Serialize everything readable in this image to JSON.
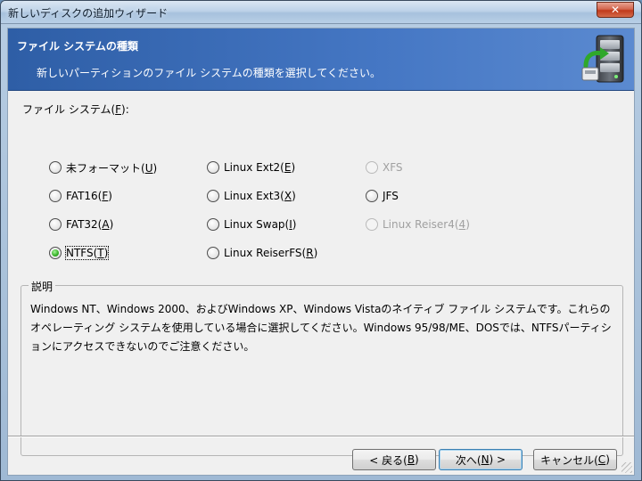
{
  "window": {
    "title": "新しいディスクの追加ウィザード",
    "close_label": "✕"
  },
  "header": {
    "title": "ファイル システムの種類",
    "subtitle": "新しいパーティションのファイル システムの種類を選択してください。",
    "icon": "server-disk-icon"
  },
  "filesystem": {
    "label_prefix": "ファイル システム(",
    "label_key": "F",
    "label_suffix": "):",
    "options": [
      {
        "prefix": "未フォーマット(",
        "key": "U",
        "suffix": ")",
        "checked": false,
        "disabled": false
      },
      {
        "prefix": "FAT16(",
        "key": "F",
        "suffix": ")",
        "checked": false,
        "disabled": false
      },
      {
        "prefix": "FAT32(",
        "key": "A",
        "suffix": ")",
        "checked": false,
        "disabled": false
      },
      {
        "prefix": "NTFS(",
        "key": "T",
        "suffix": ")",
        "checked": true,
        "disabled": false
      },
      {
        "prefix": "Linux Ext2(",
        "key": "E",
        "suffix": ")",
        "checked": false,
        "disabled": false
      },
      {
        "prefix": "Linux Ext3(",
        "key": "X",
        "suffix": ")",
        "checked": false,
        "disabled": false
      },
      {
        "prefix": "Linux Swap(",
        "key": "I",
        "suffix": ")",
        "checked": false,
        "disabled": false
      },
      {
        "prefix": "Linux ReiserFS(",
        "key": "R",
        "suffix": ")",
        "checked": false,
        "disabled": false
      },
      {
        "prefix": "XFS",
        "key": "",
        "suffix": "",
        "checked": false,
        "disabled": true
      },
      {
        "prefix": "JFS",
        "key": "",
        "suffix": "",
        "checked": false,
        "disabled": false
      },
      {
        "prefix": "Linux Reiser4(",
        "key": "4",
        "suffix": ")",
        "checked": false,
        "disabled": true
      }
    ]
  },
  "description": {
    "title": "説明",
    "text": "Windows NT、Windows 2000、およびWindows XP、Windows Vistaのネイティブ ファイル システムです。これらのオペレーティング システムを使用している場合に選択してください。Windows 95/98/ME、DOSでは、NTFSパーティションにアクセスできないのでご注意ください。"
  },
  "buttons": {
    "back": {
      "prefix": "< 戻る(",
      "key": "B",
      "suffix": ")"
    },
    "next": {
      "prefix": "次へ(",
      "key": "N",
      "suffix": ") >"
    },
    "cancel": {
      "prefix": "キャンセル(",
      "key": "C",
      "suffix": ")"
    }
  }
}
